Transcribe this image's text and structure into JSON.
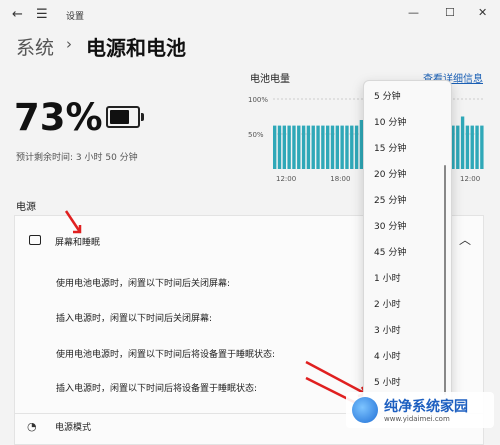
{
  "window": {
    "title": "设置"
  },
  "header": {
    "breadcrumb_parent": "系统",
    "page_title": "电源和电池"
  },
  "battery": {
    "percent": "73%",
    "remaining": "预计剩余时间: 3 小时 50 分钟",
    "level": 0.73
  },
  "chart_data": {
    "type": "bar",
    "title": "电池电量",
    "y_ticks": [
      "100%",
      "50%"
    ],
    "x_ticks": [
      "12:00",
      "18:00",
      "12:00"
    ],
    "values": [
      62,
      62,
      62,
      62,
      62,
      62,
      62,
      62,
      62,
      62,
      62,
      62,
      62,
      62,
      62,
      62,
      62,
      62,
      70,
      66,
      62,
      62,
      62,
      62,
      62,
      62,
      62,
      62,
      62,
      62,
      62,
      62,
      62,
      62,
      62,
      62,
      62,
      62,
      62,
      75,
      62,
      62,
      62,
      62
    ]
  },
  "details_link": "查看详细信息",
  "power_section_label": "电源",
  "screen_sleep": {
    "label": "屏幕和睡眠",
    "rows": [
      "使用电池电源时，闲置以下时间后关闭屏幕:",
      "插入电源时，闲置以下时间后关闭屏幕:",
      "使用电池电源时，闲置以下时间后将设备置于睡眠状态:",
      "插入电源时，闲置以下时间后将设备置于睡眠状态:"
    ]
  },
  "power_mode": {
    "label": "电源模式"
  },
  "dropdown": {
    "options": [
      "5 分钟",
      "10 分钟",
      "15 分钟",
      "20 分钟",
      "25 分钟",
      "30 分钟",
      "45 分钟",
      "1 小时",
      "2 小时",
      "3 小时",
      "4 小时",
      "5 小时"
    ]
  },
  "watermark": {
    "name": "纯净系统家园",
    "url": "www.yidaimei.com"
  },
  "colors": {
    "bar": "#2fa8b8",
    "accent": "#1a5fb4",
    "arrow": "#e02020"
  }
}
